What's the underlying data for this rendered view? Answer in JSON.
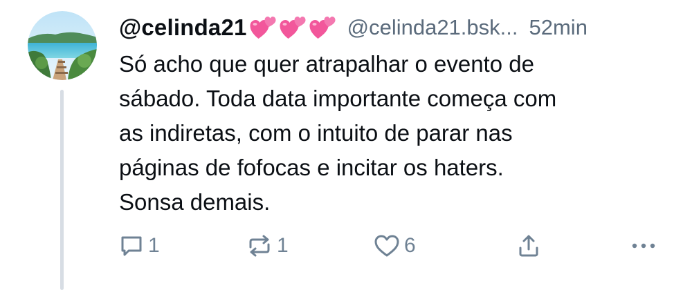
{
  "post": {
    "display_name": "@celinda21",
    "name_emoji": "two-hearts-emoji x3",
    "handle": "@celinda21.bsk...",
    "time": "52min",
    "text_lines": [
      "Só acho que quer atrapalhar o evento de",
      "sábado. Toda data importante começa com",
      "as indiretas, com o intuito de parar nas",
      "páginas de fofocas e incitar os haters.",
      "Sonsa demais."
    ],
    "actions": {
      "reply_count": "1",
      "repost_count": "1",
      "like_count": "6"
    }
  },
  "colors": {
    "text": "#0b0f14",
    "muted": "#5b6b7c",
    "icon": "#6f8294",
    "thread_line": "#d7dde4",
    "heart_emoji": "#f2579b"
  }
}
